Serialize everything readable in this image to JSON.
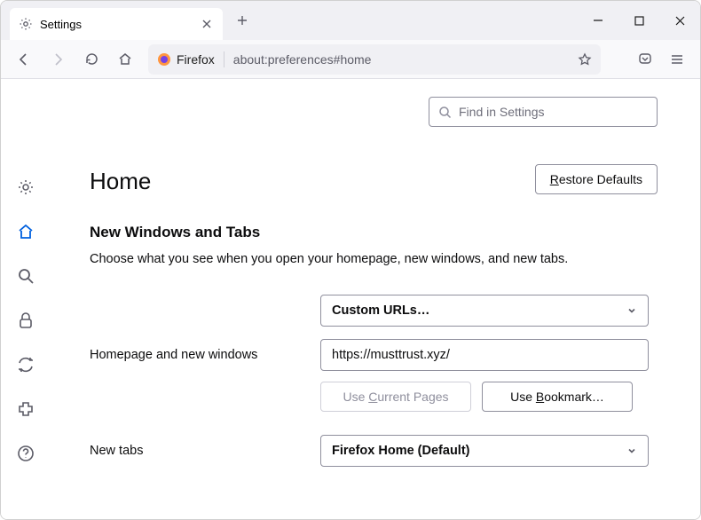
{
  "tab": {
    "title": "Settings"
  },
  "urlbar": {
    "browser_label": "Firefox",
    "url": "about:preferences#home"
  },
  "search": {
    "placeholder": "Find in Settings"
  },
  "page": {
    "title": "Home"
  },
  "buttons": {
    "restore_r": "R",
    "restore_rest": "estore Defaults",
    "use_current_pre": "Use ",
    "use_current_c": "C",
    "use_current_post": "urrent Pages",
    "use_bookmark_pre": "Use ",
    "use_bookmark_b": "B",
    "use_bookmark_post": "ookmark…"
  },
  "section": {
    "heading": "New Windows and Tabs",
    "description": "Choose what you see when you open your homepage, new windows, and new tabs."
  },
  "homepage": {
    "custom_urls_label": "Custom URLs…",
    "label": "Homepage and new windows",
    "value": "https://musttrust.xyz/"
  },
  "newtabs": {
    "label": "New tabs",
    "value": "Firefox Home (Default)"
  }
}
